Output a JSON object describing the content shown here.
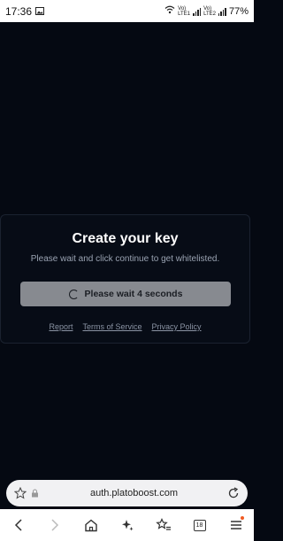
{
  "status_bar": {
    "time": "17:36",
    "sim1_label_top": "Vo)",
    "sim1_label_bottom": "LTE1",
    "sim2_label_top": "Vo)",
    "sim2_label_bottom": "LTE2",
    "battery": "77%"
  },
  "card": {
    "title": "Create your key",
    "subtitle": "Please wait and click continue to get whitelisted.",
    "button_label": "Please wait 4 seconds",
    "links": {
      "report": "Report",
      "terms": "Terms of Service",
      "privacy": "Privacy Policy"
    }
  },
  "browser": {
    "url": "auth.platoboost.com",
    "tab_count": "18"
  },
  "colors": {
    "page_bg": "#050912",
    "button_bg": "#878a90",
    "notification_dot": "#f05a22"
  }
}
